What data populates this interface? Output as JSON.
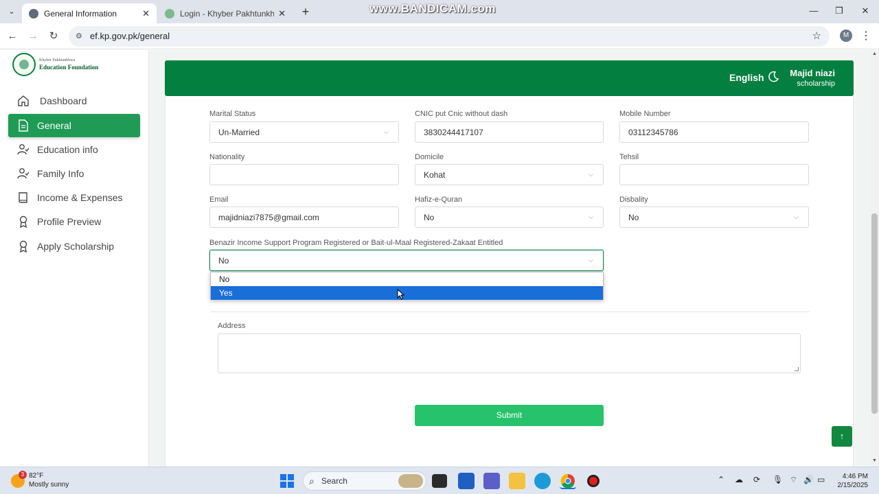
{
  "browser": {
    "tabs": [
      {
        "title": "General Information",
        "active": true
      },
      {
        "title": "Login - Khyber Pakhtunkhwa Ed",
        "active": false
      }
    ],
    "url": "ef.kp.gov.pk/general",
    "watermark": "www.BANDICAM.com",
    "profile_initial": "M"
  },
  "sidebar": {
    "logo": {
      "line1": "Khyber Pakhtunkhwa",
      "line2": "Education Foundation"
    },
    "items": [
      {
        "label": "Dashboard",
        "icon": "home-icon",
        "active": false
      },
      {
        "label": "General",
        "icon": "document-icon",
        "active": true
      },
      {
        "label": "Education info",
        "icon": "user-check-icon",
        "active": false
      },
      {
        "label": "Family Info",
        "icon": "user-check-icon",
        "active": false
      },
      {
        "label": "Income & Expenses",
        "icon": "book-icon",
        "active": false
      },
      {
        "label": "Profile Preview",
        "icon": "award-icon",
        "active": false
      },
      {
        "label": "Apply Scholarship",
        "icon": "award-icon",
        "active": false
      }
    ]
  },
  "header": {
    "language": "English",
    "user_name": "Majid niazi",
    "user_role": "scholarship"
  },
  "form": {
    "marital_status": {
      "label": "Marital Status",
      "value": "Un-Married"
    },
    "cnic": {
      "label": "CNIC put Cnic without dash",
      "value": "3830244417107"
    },
    "mobile": {
      "label": "Mobile Number",
      "value": "03112345786"
    },
    "nationality": {
      "label": "Nationality",
      "value": ""
    },
    "domicile": {
      "label": "Domicile",
      "value": "Kohat"
    },
    "tehsil": {
      "label": "Tehsil",
      "value": ""
    },
    "email": {
      "label": "Email",
      "value": "majidniazi7875@gmail.com"
    },
    "hafiz": {
      "label": "Hafiz-e-Quran",
      "value": "No"
    },
    "disability": {
      "label": "Disbality",
      "value": "No"
    },
    "bisp": {
      "label": "Benazir Income Support Program Registered or Bait-ul-Maal Registered-Zakaat Entitled",
      "value": "No",
      "options": [
        "No",
        "Yes"
      ],
      "highlighted": "Yes"
    },
    "address": {
      "label": "Address",
      "value": ""
    },
    "submit_label": "Submit"
  },
  "taskbar": {
    "weather_temp": "82°F",
    "weather_desc": "Mostly sunny",
    "weather_badge": "3",
    "search_label": "Search",
    "time": "4:46 PM",
    "date": "2/15/2025"
  },
  "colors": {
    "brand_green": "#037f40",
    "sidebar_active": "#1f9b55",
    "submit_green": "#27c26c",
    "selection_blue": "#1a6ed8"
  }
}
